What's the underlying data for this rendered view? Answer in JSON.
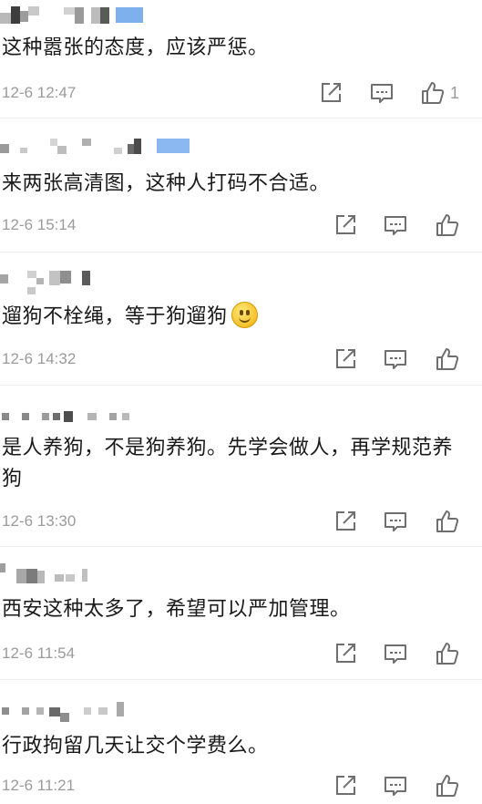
{
  "comments": [
    {
      "text": "这种嚣张的态度，应该严惩。",
      "time": "12-6 12:47",
      "likes": "1"
    },
    {
      "text": "来两张高清图，这种人打码不合适。",
      "time": "12-6 15:14",
      "likes": ""
    },
    {
      "text": "遛狗不栓绳，等于狗遛狗",
      "time": "12-6 14:32",
      "likes": "",
      "emoji": "smile-emoji"
    },
    {
      "text": "是人养狗，不是狗养狗。先学会做人，再学规范养狗",
      "time": "12-6 13:30",
      "likes": ""
    },
    {
      "text": "西安这种太多了，希望可以严加管理。",
      "time": "12-6 11:54",
      "likes": ""
    },
    {
      "text": "行政拘留几天让交个学费么。",
      "time": "12-6 11:21",
      "likes": ""
    }
  ],
  "icons": {
    "share": "share-icon",
    "comment": "comment-icon",
    "like": "thumbs-up-icon"
  },
  "colors": {
    "text": "#1a1a1a",
    "meta": "#9b9b9b",
    "icon": "#6f6f6f",
    "divider": "#ececec",
    "badge_blue": "#7fb0ee"
  }
}
